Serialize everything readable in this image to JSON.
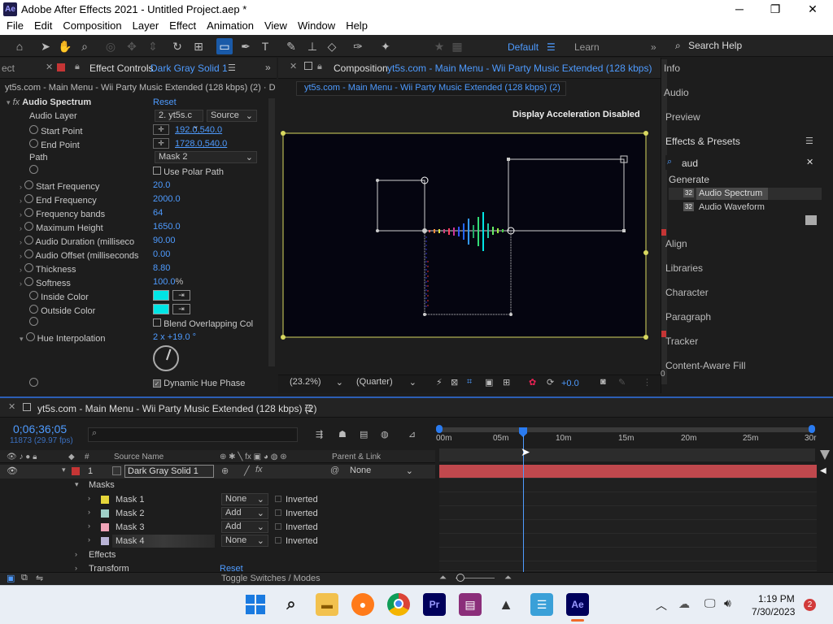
{
  "window": {
    "title": "Adobe After Effects 2021 - Untitled Project.aep *",
    "logo": "Ae",
    "minimize": "─",
    "maximize": "❐",
    "close": "✕"
  },
  "menu": [
    "File",
    "Edit",
    "Composition",
    "Layer",
    "Effect",
    "Animation",
    "View",
    "Window",
    "Help"
  ],
  "toolbar": {
    "workspace_default": "Default",
    "workspace_learn": "Learn",
    "search_help": "Search Help",
    "more": "»"
  },
  "effect_controls": {
    "left_tab": "ect",
    "tab_label": "Effect Controls",
    "tab_layer": "Dark Gray Solid 1",
    "header": "yt5s.com - Main Menu - Wii Party Music Extended (128 kbps) (2) · D",
    "effect_name": "Audio Spectrum",
    "reset": "Reset",
    "audio_layer_label": "Audio Layer",
    "audio_layer_value": "2. yt5s.c",
    "audio_layer_source": "Source",
    "start_point_label": "Start Point",
    "start_point_value": "192.0,540.0",
    "end_point_label": "End Point",
    "end_point_value": "1728.0,540.0",
    "path_label": "Path",
    "path_value": "Mask 2",
    "use_polar_path": "Use Polar Path",
    "start_frequency_label": "Start Frequency",
    "start_frequency_value": "20.0",
    "end_frequency_label": "End Frequency",
    "end_frequency_value": "2000.0",
    "frequency_bands_label": "Frequency bands",
    "frequency_bands_value": "64",
    "maximum_height_label": "Maximum Height",
    "maximum_height_value": "1650.0",
    "audio_duration_label": "Audio Duration (milliseco",
    "audio_duration_value": "90.00",
    "audio_offset_label": "Audio Offset (milliseconds",
    "audio_offset_value": "0.00",
    "thickness_label": "Thickness",
    "thickness_value": "8.80",
    "softness_label": "Softness",
    "softness_value": "100.0",
    "softness_unit": "%",
    "inside_color_label": "Inside Color",
    "outside_color_label": "Outside Color",
    "swatch_color": "#00e5e5",
    "blend_overlapping": "Blend Overlapping Col",
    "hue_interpolation_label": "Hue Interpolation",
    "hue_interpolation_value": "2 x +19.0 °",
    "dynamic_hue_phase": "Dynamic Hue Phase"
  },
  "composition": {
    "tab_label": "Composition",
    "tab_name": "yt5s.com - Main Menu - Wii Party Music Extended (128 kbps)",
    "flow_tab": "yt5s.com - Main Menu - Wii Party Music Extended (128 kbps) (2)",
    "overlay_text": "Display Acceleration Disabled",
    "zoom": "(23.2%)",
    "resolution": "(Quarter)",
    "exposure": "+0.0"
  },
  "right_panels": {
    "info": "Info",
    "audio": "Audio",
    "preview": "Preview",
    "effects_presets": "Effects & Presets",
    "search_value": "aud",
    "category": "Generate",
    "item_1": "Audio Spectrum",
    "item_2": "Audio Waveform",
    "align": "Align",
    "libraries": "Libraries",
    "character": "Character",
    "paragraph": "Paragraph",
    "tracker": "Tracker",
    "content_aware_fill": "Content-Aware Fill",
    "zero": "0"
  },
  "timeline": {
    "tab_label": "yt5s.com - Main Menu - Wii Party Music Extended (128 kbps) (2)",
    "timecode": "0;06;36;05",
    "frames": "11873 (29.97 fps)",
    "col_source_name": "Source Name",
    "col_parent": "Parent & Link",
    "layer_num": "1",
    "layer_name": "Dark Gray Solid 1",
    "layer_parent": "None",
    "masks_label": "Masks",
    "masks": [
      {
        "name": "Mask 1",
        "mode": "None",
        "inverted": "Inverted",
        "color": "#e6d63a"
      },
      {
        "name": "Mask 2",
        "mode": "Add",
        "inverted": "Inverted",
        "color": "#9fd0c8"
      },
      {
        "name": "Mask 3",
        "mode": "Add",
        "inverted": "Inverted",
        "color": "#f0a4b8"
      },
      {
        "name": "Mask 4",
        "mode": "None",
        "inverted": "Inverted",
        "color": "#b9b4d6"
      }
    ],
    "effects_label": "Effects",
    "transform_label": "Transform",
    "transform_reset": "Reset",
    "toggle_switches": "Toggle Switches / Modes",
    "ruler": [
      "00m",
      "05m",
      "10m",
      "15m",
      "20m",
      "25m",
      "30r"
    ],
    "playhead_fraction": 0.22,
    "layer_bar_color": "#c0484d"
  },
  "taskbar": {
    "time": "1:19 PM",
    "date": "7/30/2023",
    "notifications": "2",
    "apps": [
      "Start",
      "Search",
      "File Explorer",
      "Firefox",
      "Chrome",
      "Premiere Pro",
      "WinRAR",
      "Inkscape",
      "Notepad",
      "After Effects"
    ]
  }
}
